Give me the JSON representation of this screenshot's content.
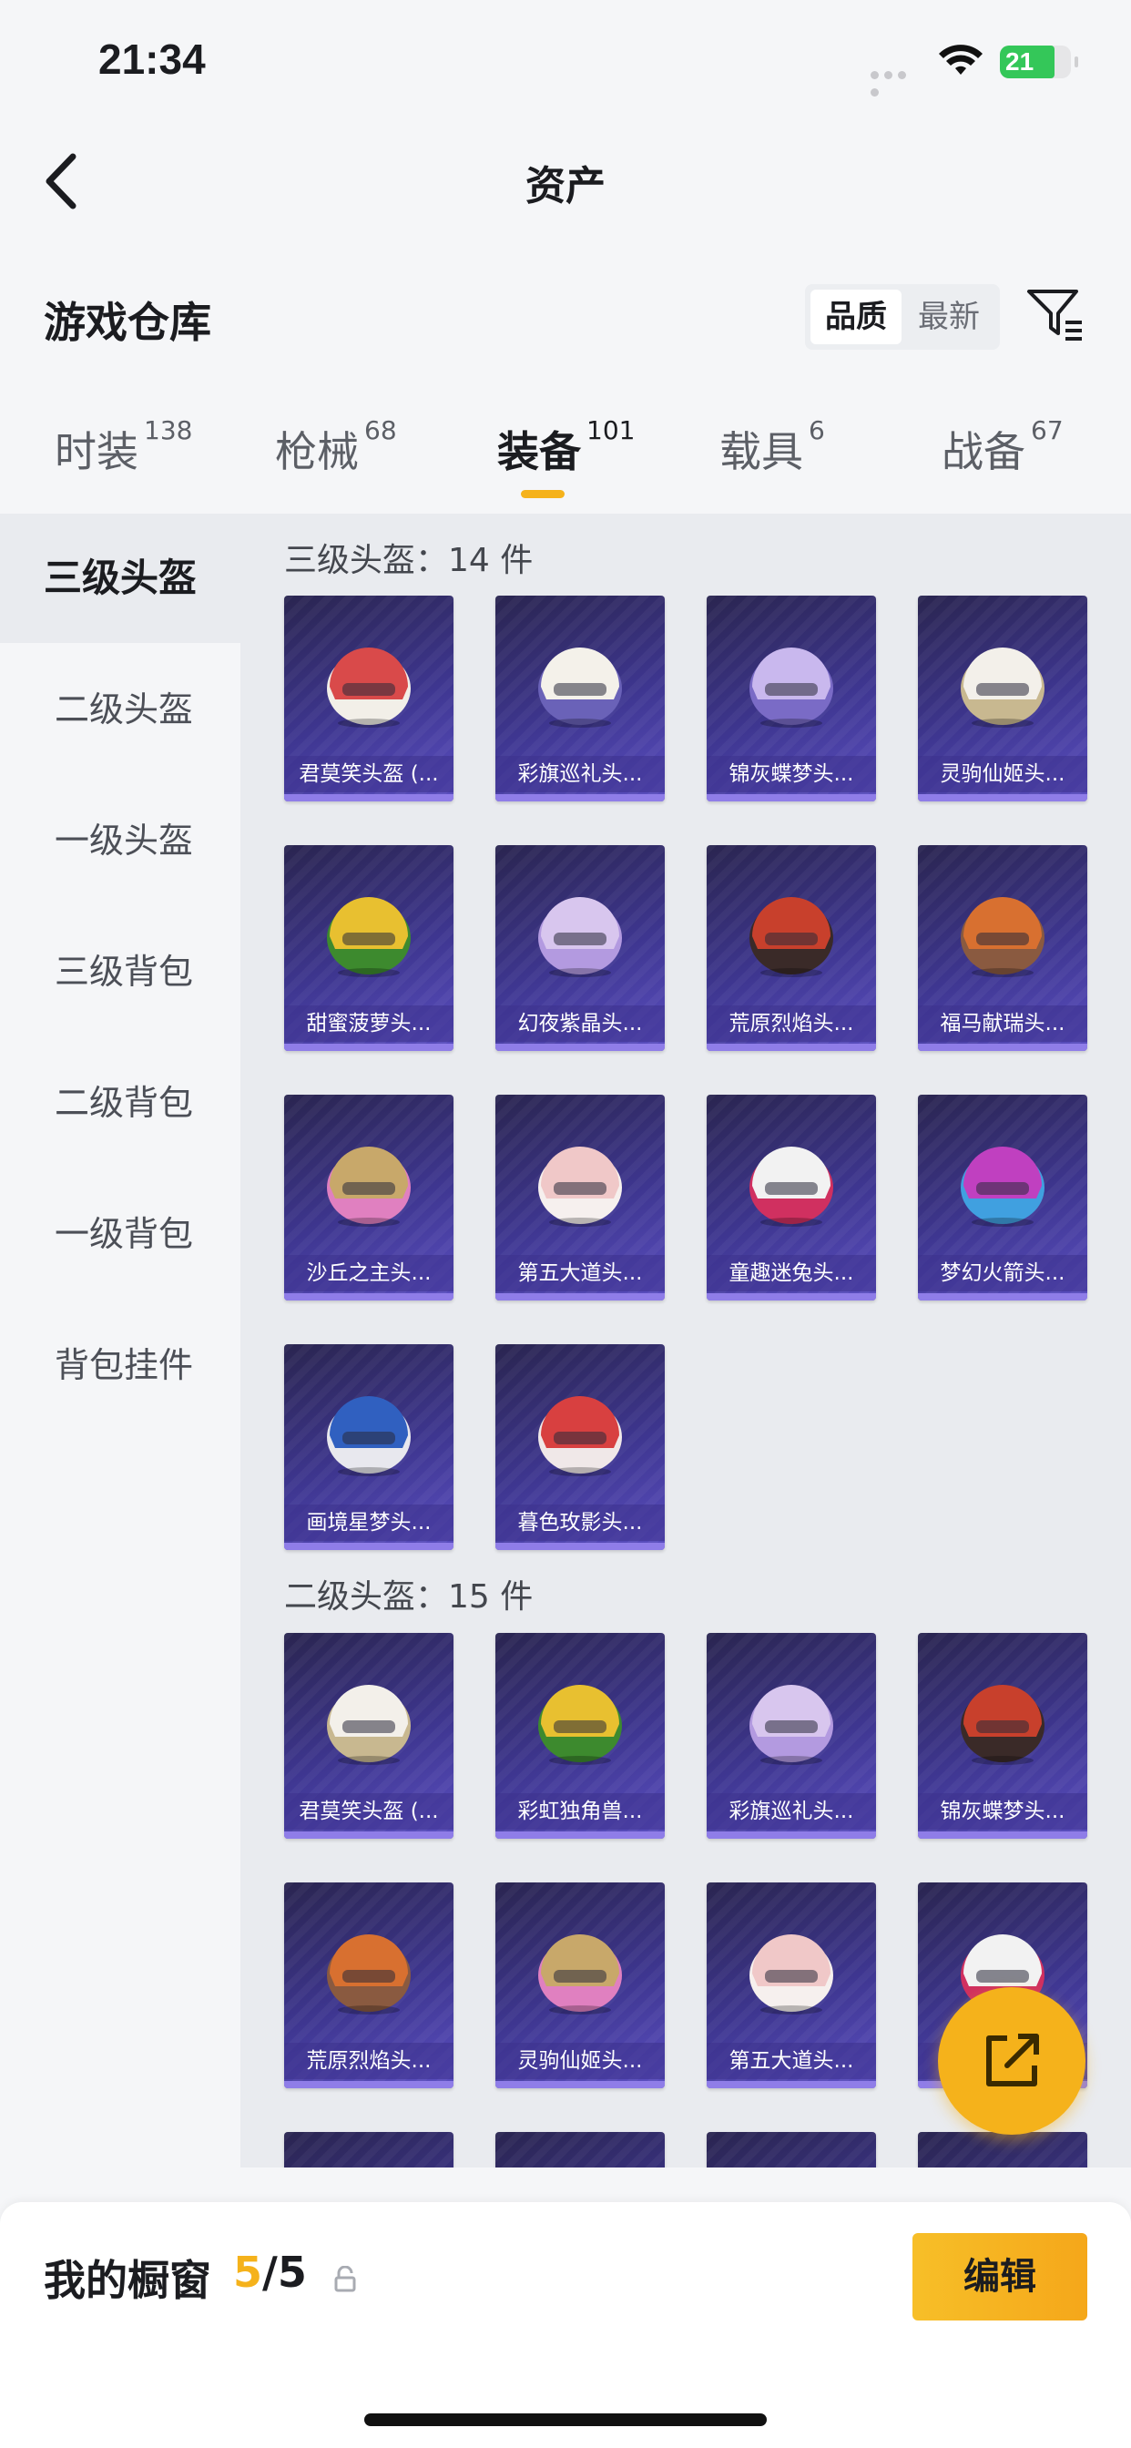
{
  "status_bar": {
    "time": "21:34",
    "battery": "21"
  },
  "nav": {
    "title": "资产"
  },
  "header": {
    "title": "游戏仓库",
    "sort_options": [
      "品质",
      "最新"
    ],
    "sort_selected": "品质"
  },
  "tabs": [
    {
      "label": "时装",
      "count": "138"
    },
    {
      "label": "枪械",
      "count": "68"
    },
    {
      "label": "装备",
      "count": "101"
    },
    {
      "label": "载具",
      "count": "6"
    },
    {
      "label": "战备",
      "count": "67"
    }
  ],
  "active_tab": "装备",
  "sidebar": [
    "三级头盔",
    "二级头盔",
    "一级头盔",
    "三级背包",
    "二级背包",
    "一级背包",
    "背包挂件"
  ],
  "groups": [
    {
      "title": "三级头盔：14 件",
      "items": [
        "君莫笑头盔 (...",
        "彩旗巡礼头...",
        "锦灰蝶梦头...",
        "灵驹仙姬头...",
        "甜蜜菠萝头...",
        "幻夜紫晶头...",
        "荒原烈焰头...",
        "福马献瑞头...",
        "沙丘之主头...",
        "第五大道头...",
        "童趣迷兔头...",
        "梦幻火箭头...",
        "画境星梦头...",
        "暮色玫影头..."
      ]
    },
    {
      "title": "二级头盔：15 件",
      "items": [
        "君莫笑头盔 (...",
        "彩虹独角兽...",
        "彩旗巡礼头...",
        "锦灰蝶梦头...",
        "荒原烈焰头...",
        "灵驹仙姬头...",
        "第五大道头...",
        ""
      ]
    }
  ],
  "footer": {
    "title": "我的橱窗",
    "current": "5",
    "total": "/5",
    "edit_label": "编辑"
  },
  "colors": {
    "accent": "#f5b21b",
    "card_bg": "#3e3690"
  }
}
